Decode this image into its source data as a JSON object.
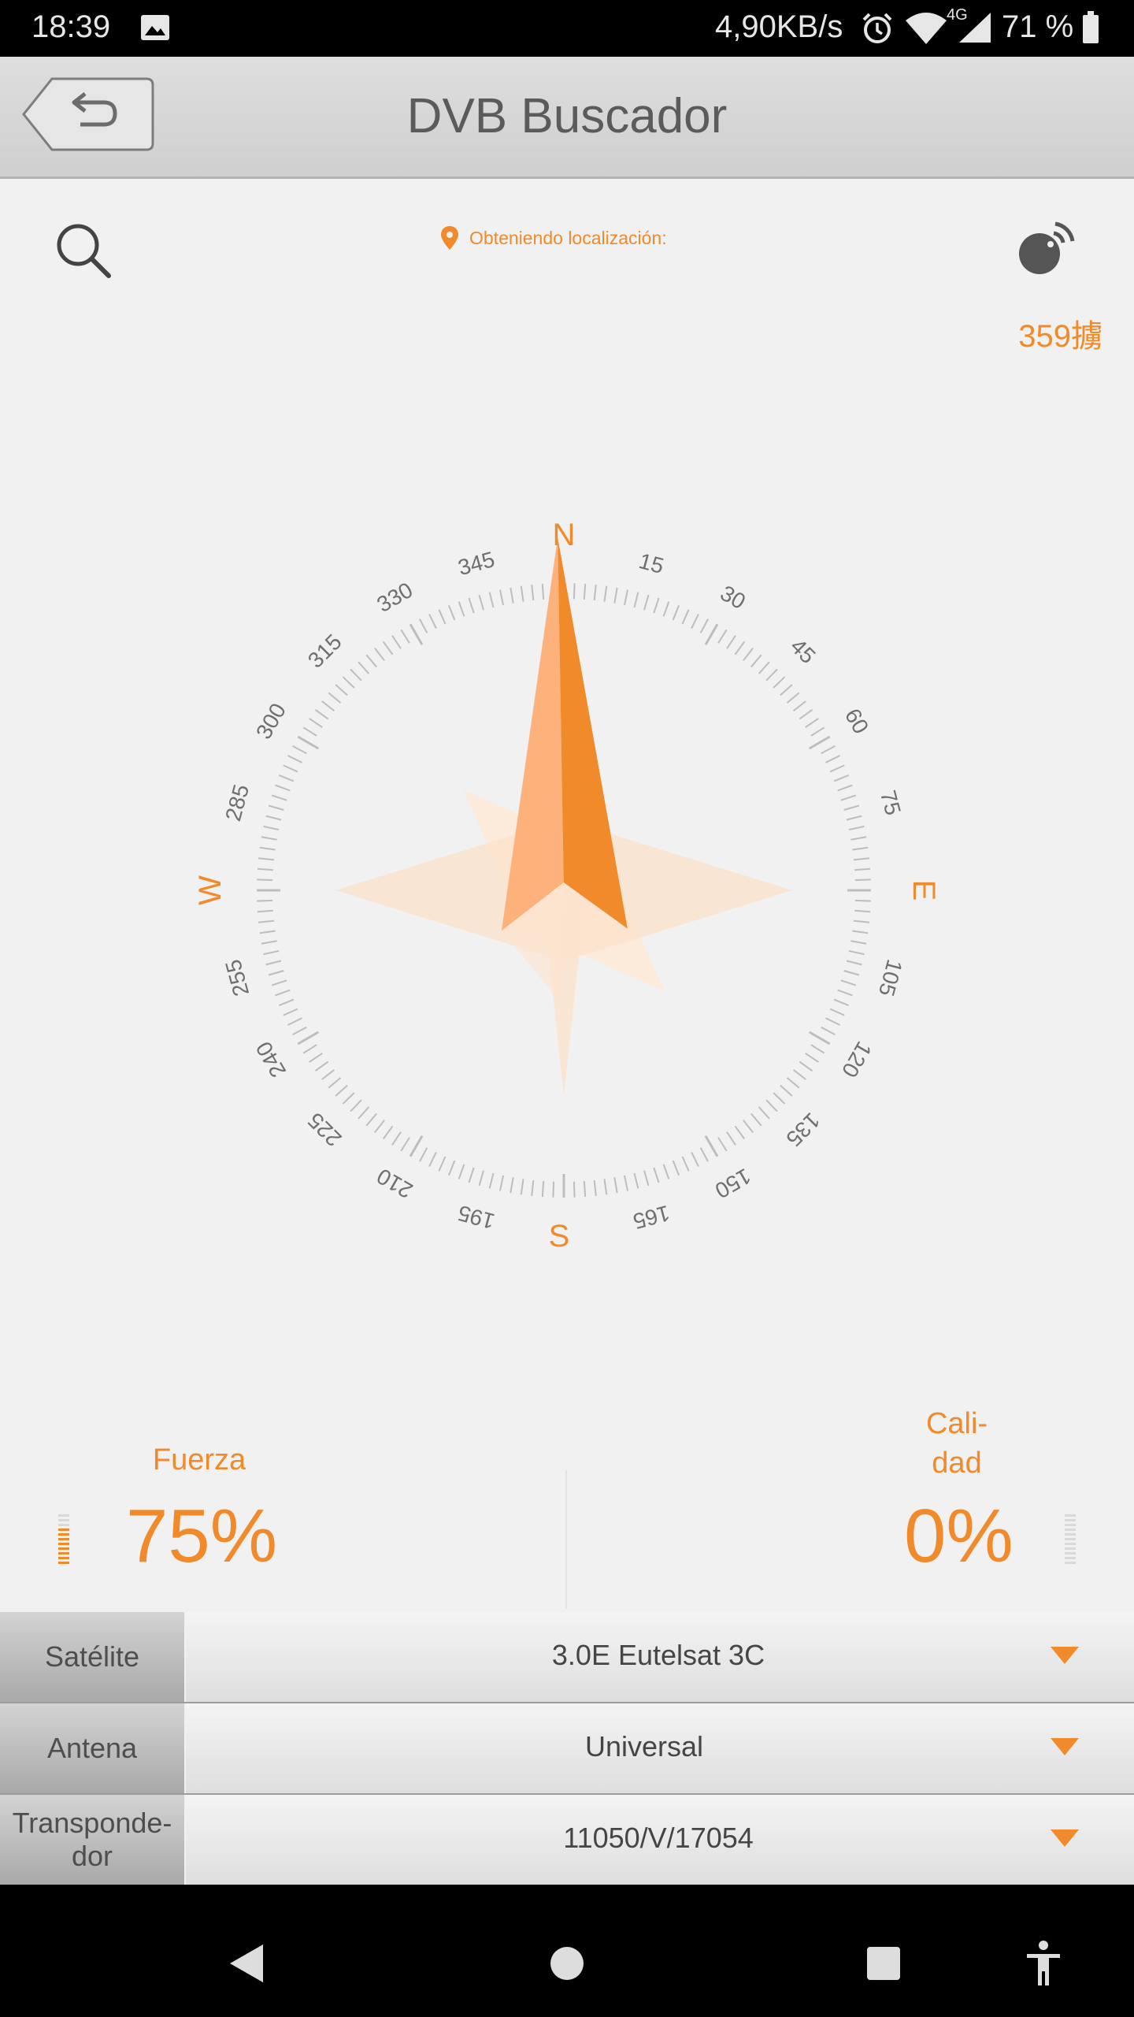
{
  "status_bar": {
    "time": "18:39",
    "network_speed": "4,90KB/s",
    "network_type": "4G",
    "battery": "71 %",
    "icons": [
      "image-icon",
      "alarm-icon",
      "wifi-icon",
      "signal-icon",
      "battery-icon"
    ]
  },
  "app_bar": {
    "title": "DVB Buscador",
    "back_icon": "back-arrow-icon"
  },
  "toolbar": {
    "search_icon": "search-icon",
    "location_text": "Obteniendo localización:",
    "satellite_icon": "satellite-dish-icon",
    "heading": "359擄"
  },
  "compass": {
    "needle_heading_deg": 359,
    "cardinals": {
      "n": "N",
      "e": "E",
      "s": "S",
      "w": "W"
    },
    "tick_labels": [
      "15",
      "30",
      "45",
      "60",
      "75",
      "105",
      "120",
      "135",
      "150",
      "165",
      "195",
      "210",
      "225",
      "240",
      "255",
      "285",
      "300",
      "315",
      "330",
      "345"
    ],
    "colors": {
      "accent": "#f08a2a",
      "accent_light": "#fdb27c",
      "ticks": "#bdbdbd",
      "labels": "#6f6f6f"
    }
  },
  "signal": {
    "strength_label": "Fuerza",
    "strength_value": "75%",
    "strength_level": 0.75,
    "quality_label_line1": "Cali-",
    "quality_label_line2": "dad",
    "quality_value": "0%",
    "quality_level": 0
  },
  "settings": {
    "satellite": {
      "label": "Satélite",
      "value": "3.0E Eutelsat 3C"
    },
    "antenna": {
      "label": "Antena",
      "value": "Universal"
    },
    "transponder": {
      "label_line1": "Transponde-",
      "label_line2": "dor",
      "value": "11050/V/17054"
    }
  },
  "nav_bar": {
    "buttons": [
      "back-icon",
      "home-icon",
      "recents-icon",
      "accessibility-icon"
    ]
  }
}
